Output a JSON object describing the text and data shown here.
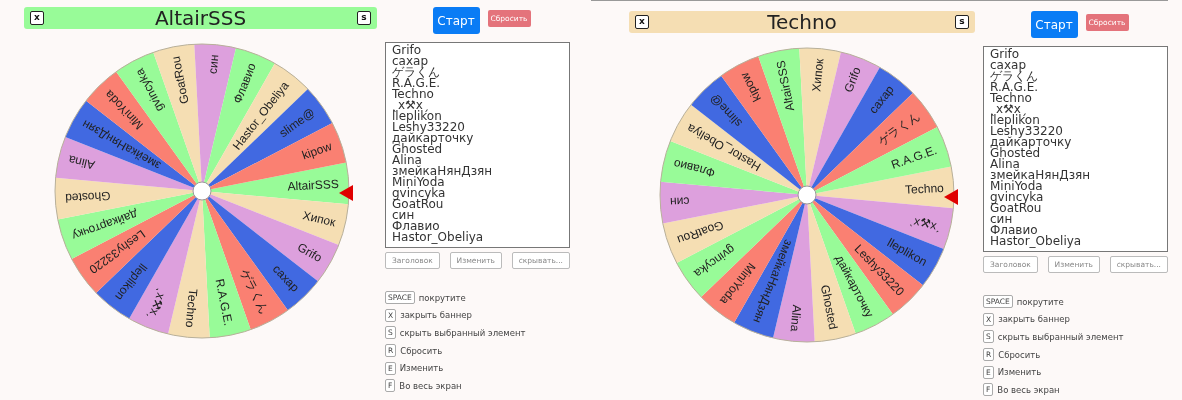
{
  "panels": [
    {
      "banner": {
        "title": "AltairSSS",
        "close_key": "x",
        "hide_key": "s"
      },
      "segments": [
        {
          "label": "AltairSSS",
          "color": "#98fb98"
        },
        {
          "label": "Хипок",
          "color": "#f5deb3"
        },
        {
          "label": "Grifo",
          "color": "#dda0dd"
        },
        {
          "label": "сахар",
          "color": "#4169e1"
        },
        {
          "label": "ゲラくん",
          "color": "#fa8072"
        },
        {
          "label": "R.A.G.E.",
          "color": "#98fb98"
        },
        {
          "label": "Techno",
          "color": "#f5deb3"
        },
        {
          "label": "ˎx⚒xˏ",
          "color": "#dda0dd"
        },
        {
          "label": "lleplikon",
          "color": "#4169e1"
        },
        {
          "label": "Leshy33220",
          "color": "#fa8072"
        },
        {
          "label": "дайкарточку",
          "color": "#98fb98"
        },
        {
          "label": "Ghosted",
          "color": "#f5deb3"
        },
        {
          "label": "Alina",
          "color": "#dda0dd"
        },
        {
          "label": "змейкаНянДзян",
          "color": "#4169e1"
        },
        {
          "label": "MiniYoda",
          "color": "#fa8072"
        },
        {
          "label": "gvincyka",
          "color": "#98fb98"
        },
        {
          "label": "GoatRou",
          "color": "#f5deb3"
        },
        {
          "label": "син",
          "color": "#dda0dd"
        },
        {
          "label": "Флавио",
          "color": "#98fb98"
        },
        {
          "label": "Hastor_Obeliya",
          "color": "#f5deb3"
        },
        {
          "label": "slime@",
          "color": "#4169e1"
        },
        {
          "label": "kipow",
          "color": "#fa8072"
        }
      ],
      "start_button": "Старт",
      "reset_button": "Сбросить",
      "entries": [
        "Grifo",
        "сахар",
        "ゲラくん",
        "R.A.G.E.",
        "Techno",
        "ˎx⚒xˏ",
        "lleplikon",
        "Leshy33220",
        "дайкарточку",
        "Ghosted",
        "Alina",
        "змейкаНянДзян",
        "MiniYoda",
        "gvincyka",
        "GoatRou",
        "син",
        "Флавио",
        "Hastor_Obeliya"
      ],
      "tool_buttons": [
        "Заголовок",
        "Изменить",
        "скрывать..."
      ],
      "shortcuts": [
        {
          "key": "SPACE",
          "label": "покрутите"
        },
        {
          "key": "X",
          "label": "закрыть баннер"
        },
        {
          "key": "S",
          "label": "скрыть выбранный элемент"
        },
        {
          "key": "R",
          "label": "Сбросить"
        },
        {
          "key": "E",
          "label": "Изменить"
        },
        {
          "key": "F",
          "label": "Во весь экран"
        }
      ]
    },
    {
      "banner": {
        "title": "Techno",
        "close_key": "x",
        "hide_key": "s"
      },
      "segments": [
        {
          "label": "Techno",
          "color": "#f5deb3"
        },
        {
          "label": "ˎx⚒xˏ",
          "color": "#dda0dd"
        },
        {
          "label": "lleplikon",
          "color": "#4169e1"
        },
        {
          "label": "Leshy33220",
          "color": "#fa8072"
        },
        {
          "label": "дайкарточку",
          "color": "#98fb98"
        },
        {
          "label": "Ghosted",
          "color": "#f5deb3"
        },
        {
          "label": "Alina",
          "color": "#dda0dd"
        },
        {
          "label": "змейкаНянДзян",
          "color": "#4169e1"
        },
        {
          "label": "MiniYoda",
          "color": "#fa8072"
        },
        {
          "label": "gvincyka",
          "color": "#98fb98"
        },
        {
          "label": "GoatRou",
          "color": "#f5deb3"
        },
        {
          "label": "син",
          "color": "#dda0dd"
        },
        {
          "label": "Флавио",
          "color": "#98fb98"
        },
        {
          "label": "Hastor_Obeliya",
          "color": "#f5deb3"
        },
        {
          "label": "slime@",
          "color": "#4169e1"
        },
        {
          "label": "kipow",
          "color": "#fa8072"
        },
        {
          "label": "AltairSSS",
          "color": "#98fb98"
        },
        {
          "label": "Хипок",
          "color": "#f5deb3"
        },
        {
          "label": "Grifo",
          "color": "#dda0dd"
        },
        {
          "label": "сахар",
          "color": "#4169e1"
        },
        {
          "label": "ゲラくん",
          "color": "#fa8072"
        },
        {
          "label": "R.A.G.E.",
          "color": "#98fb98"
        }
      ],
      "start_button": "Старт",
      "reset_button": "Сбросить",
      "entries": [
        "Grifo",
        "сахар",
        "ゲラくん",
        "R.A.G.E.",
        "Techno",
        "ˎx⚒xˏ",
        "lleplikon",
        "Leshy33220",
        "дайкарточку",
        "Ghosted",
        "Alina",
        "змейкаНянДзян",
        "MiniYoda",
        "gvincyka",
        "GoatRou",
        "син",
        "Флавио",
        "Hastor_Obeliya"
      ],
      "tool_buttons": [
        "Заголовок",
        "Изменить",
        "скрывать..."
      ],
      "shortcuts": [
        {
          "key": "SPACE",
          "label": "покрутите"
        },
        {
          "key": "X",
          "label": "закрыть баннер"
        },
        {
          "key": "S",
          "label": "скрыть выбранный элемент"
        },
        {
          "key": "R",
          "label": "Сбросить"
        },
        {
          "key": "E",
          "label": "Изменить"
        },
        {
          "key": "F",
          "label": "Во весь экран"
        }
      ]
    }
  ]
}
